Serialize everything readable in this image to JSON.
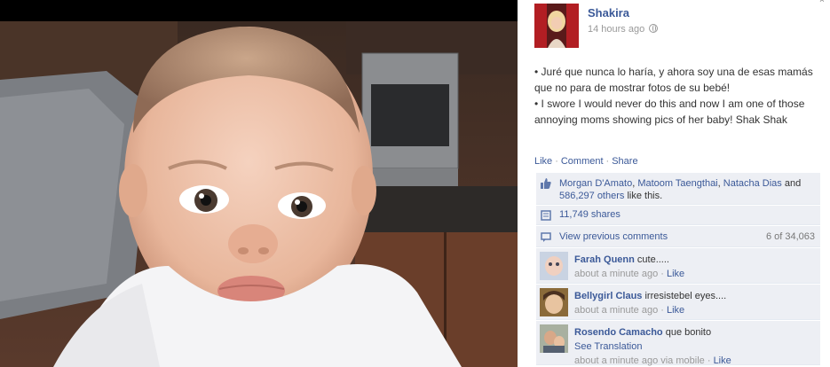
{
  "post": {
    "author": "Shakira",
    "time": "14 hours ago",
    "caption_lines": [
      "• Juré que nunca lo haría, y ahora soy una de esas mamás que no para de mostrar fotos de su bebé!",
      "• I swore I would never do this and now I am one of those annoying moms showing pics of her baby! Shak Shak"
    ]
  },
  "actions": {
    "like": "Like",
    "comment": "Comment",
    "share": "Share",
    "sep": "·"
  },
  "likes": {
    "names": [
      "Morgan D'Amato",
      "Matoom Taengthai",
      "Natacha Dias"
    ],
    "sep1": ", ",
    "and": " and ",
    "others": "586,297 others",
    "suffix": " like this."
  },
  "shares": {
    "label": "11,749 shares"
  },
  "previous": {
    "label": "View previous comments",
    "count": "6 of 34,063"
  },
  "comments": [
    {
      "author": "Farah Quenn",
      "text": "cute.....",
      "time": "about a minute ago",
      "like": "Like",
      "sep": "·"
    },
    {
      "author": "Bellygirl Claus",
      "text": "irresistebel eyes....",
      "time": "about a minute ago",
      "like": "Like",
      "sep": "·"
    },
    {
      "author": "Rosendo Camacho",
      "text": "que bonito",
      "translate": "See Translation",
      "time": "about a minute ago via mobile",
      "like": "Like",
      "sep": "·"
    }
  ],
  "close_glyph": "×",
  "colors": {
    "link": "#3b5998",
    "ufi_bg": "#edeff4",
    "photo_bg": "#000000"
  },
  "icons": [
    "close-icon",
    "globe-icon",
    "thumbs-up-icon",
    "share-icon",
    "comments-icon"
  ]
}
